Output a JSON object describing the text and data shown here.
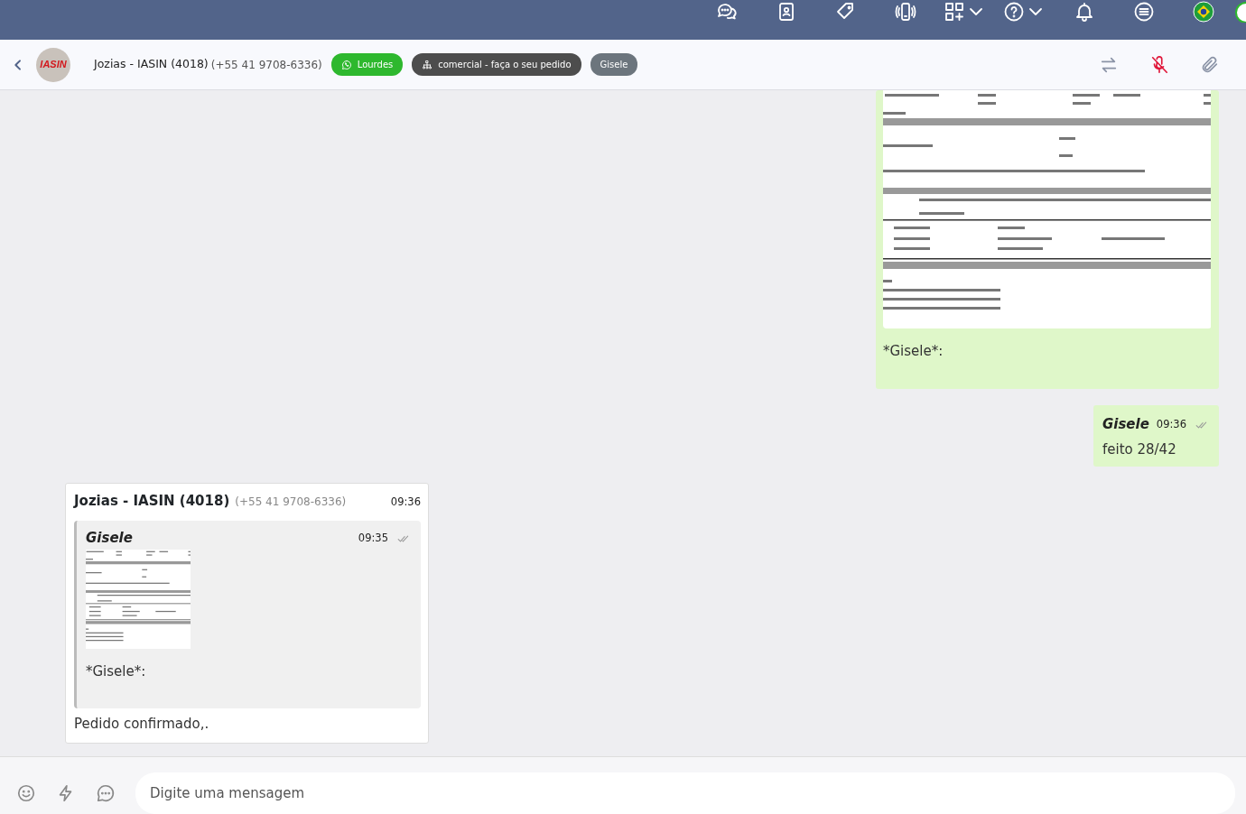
{
  "contact": {
    "logo": "IASIN",
    "name": "Jozias - IASIN (4018)",
    "phone": "(+55 41 9708-6336)"
  },
  "tags": [
    {
      "kind": "whatsapp",
      "label": "Lourdes",
      "color": "#2eb82e"
    },
    {
      "kind": "department",
      "label": "comercial - faça o seu pedido",
      "color": "#4d4d4d"
    },
    {
      "kind": "plain",
      "label": "Gisele",
      "color": "#6c757d"
    }
  ],
  "messages": [
    {
      "kind": "document",
      "outgoing": true,
      "caption": "*Gisele*:"
    },
    {
      "kind": "text",
      "outgoing": true,
      "sender": "Gisele",
      "time": "09:36",
      "text": "feito 28/42"
    },
    {
      "kind": "reply",
      "outgoing": false,
      "sender": "Jozias - IASIN (4018)",
      "phone": "(+55 41 9708-6336)",
      "time": "09:36",
      "quote": {
        "sender": "Gisele",
        "time": "09:35",
        "caption": "*Gisele*:"
      },
      "text": "Pedido confirmado,."
    }
  ],
  "composer": {
    "placeholder": "Digite uma mensagem"
  }
}
